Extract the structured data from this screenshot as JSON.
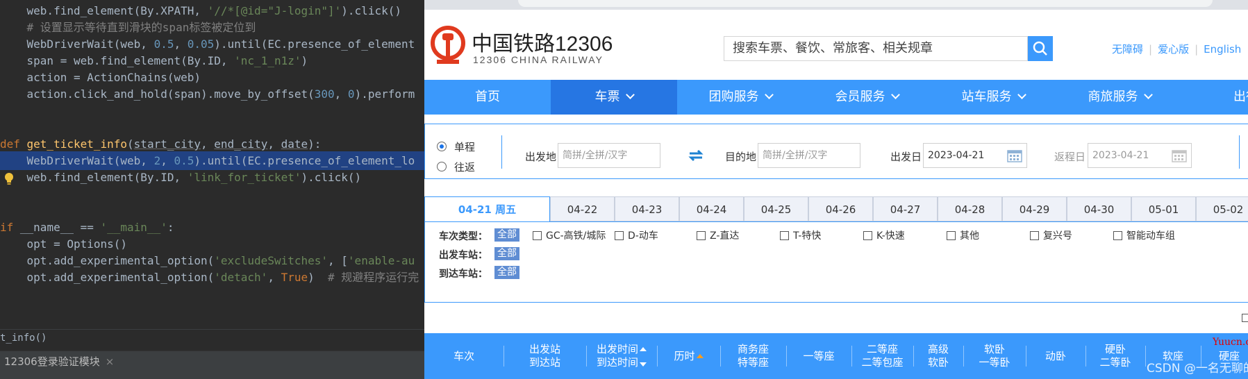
{
  "ide": {
    "lines": [
      [
        {
          "c": "",
          "t": "    web.find_element(By.XPATH, "
        },
        {
          "c": "str",
          "t": "'//*[@id=\"J-login\"]'"
        },
        {
          "c": "",
          "t": ").click()"
        }
      ],
      [
        {
          "c": "cmt",
          "t": "    # 设置显示等待直到滑块的span标签被定位到"
        }
      ],
      [
        {
          "c": "",
          "t": "    WebDriverWait(web, "
        },
        {
          "c": "num",
          "t": "0.5"
        },
        {
          "c": "",
          "t": ", "
        },
        {
          "c": "num",
          "t": "0.05"
        },
        {
          "c": "",
          "t": ").until(EC.presence_of_element"
        }
      ],
      [
        {
          "c": "",
          "t": "    span = web.find_element(By.ID, "
        },
        {
          "c": "str",
          "t": "'nc_1_n1z'"
        },
        {
          "c": "",
          "t": ")"
        }
      ],
      [
        {
          "c": "",
          "t": "    action = ActionChains(web)"
        }
      ],
      [
        {
          "c": "",
          "t": "    action.click_and_hold(span).move_by_offset("
        },
        {
          "c": "num",
          "t": "300"
        },
        {
          "c": "",
          "t": ", "
        },
        {
          "c": "num",
          "t": "0"
        },
        {
          "c": "",
          "t": ").perform"
        }
      ],
      [],
      [],
      [
        {
          "c": "kw",
          "t": "def "
        },
        {
          "c": "fn",
          "t": "get_ticket_info"
        },
        {
          "c": "",
          "t": "("
        },
        {
          "c": "param",
          "t": "start_city"
        },
        {
          "c": "",
          "t": ", "
        },
        {
          "c": "param",
          "t": "end_city"
        },
        {
          "c": "",
          "t": ", "
        },
        {
          "c": "param",
          "t": "date"
        },
        {
          "c": "",
          "t": "):"
        }
      ],
      [
        {
          "c": "",
          "t": "    WebDriverWait(web, "
        },
        {
          "c": "num",
          "t": "2"
        },
        {
          "c": "",
          "t": ", "
        },
        {
          "c": "num",
          "t": "0.5"
        },
        {
          "c": "",
          "t": ").until(EC.presence_of_element_lo"
        }
      ],
      [
        {
          "c": "",
          "t": "    web.find_element(By.ID, "
        },
        {
          "c": "str",
          "t": "'link_for_ticket'"
        },
        {
          "c": "",
          "t": ").click()"
        }
      ],
      [],
      [],
      [
        {
          "c": "kw",
          "t": "if "
        },
        {
          "c": "",
          "t": "__name__ == "
        },
        {
          "c": "str",
          "t": "'__main__'"
        },
        {
          "c": "",
          "t": ":"
        }
      ],
      [
        {
          "c": "",
          "t": "    opt = Options()"
        }
      ],
      [
        {
          "c": "",
          "t": "    opt.add_experimental_option("
        },
        {
          "c": "str",
          "t": "'excludeSwitches'"
        },
        {
          "c": "",
          "t": ", ["
        },
        {
          "c": "str",
          "t": "'enable-au"
        }
      ],
      [
        {
          "c": "",
          "t": "    opt.add_experimental_option("
        },
        {
          "c": "str",
          "t": "'detach'"
        },
        {
          "c": "",
          "t": ", "
        },
        {
          "c": "kw",
          "t": "True"
        },
        {
          "c": "",
          "t": ")  "
        },
        {
          "c": "cmt",
          "t": "# 规避程序运行完"
        }
      ]
    ],
    "status_line": "t_info()",
    "run_tab": "12306登录验证模块",
    "run_tab_close": "×"
  },
  "site": {
    "logo_cn": "中国铁路12306",
    "logo_en": "12306 CHINA RAILWAY",
    "search_placeholder": "搜索车票、餐饮、常旅客、相关规章",
    "header_links": [
      "无障碍",
      "爱心版",
      "English"
    ],
    "nav": [
      {
        "label": "首页",
        "chevron": false,
        "active": false
      },
      {
        "label": "车票",
        "chevron": true,
        "active": true
      },
      {
        "label": "团购服务",
        "chevron": true,
        "active": false
      },
      {
        "label": "会员服务",
        "chevron": true,
        "active": false
      },
      {
        "label": "站车服务",
        "chevron": true,
        "active": false
      },
      {
        "label": "商旅服务",
        "chevron": true,
        "active": false
      },
      {
        "label": "出行",
        "chevron": false,
        "active": false
      }
    ],
    "query": {
      "one_way": "单程",
      "round_trip": "往返",
      "from_label": "出发地",
      "from_placeholder": "简拼/全拼/汉字",
      "to_label": "目的地",
      "to_placeholder": "简拼/全拼/汉字",
      "depart_label": "出发日",
      "depart_value": "2023-04-21",
      "return_label": "返程日",
      "return_value": "2023-04-21"
    },
    "date_tabs": [
      "04-21 周五",
      "04-22",
      "04-23",
      "04-24",
      "04-25",
      "04-26",
      "04-27",
      "04-28",
      "04-29",
      "04-30",
      "05-01",
      "05-02"
    ],
    "filters": {
      "train_type_label": "车次类型：",
      "depart_station_label": "出发车站：",
      "arrive_station_label": "到达车站：",
      "all_label": "全部",
      "train_types": [
        "GC-高铁/城际",
        "D-动车",
        "Z-直达",
        "T-特快",
        "K-快速",
        "其他",
        "复兴号",
        "智能动车组"
      ]
    },
    "results_header": [
      {
        "l1": "车次",
        "l2": ""
      },
      {
        "l1": "出发站",
        "l2": "到达站"
      },
      {
        "l1": "出发时间",
        "l2": "到达时间"
      },
      {
        "l1": "历时",
        "l2": ""
      },
      {
        "l1": "商务座",
        "l2": "特等座"
      },
      {
        "l1": "一等座",
        "l2": ""
      },
      {
        "l1": "二等座",
        "l2": "二等包座"
      },
      {
        "l1": "高级",
        "l2": "软卧"
      },
      {
        "l1": "软卧",
        "l2": "一等卧"
      },
      {
        "l1": "动卧",
        "l2": ""
      },
      {
        "l1": "硬卧",
        "l2": "二等卧"
      },
      {
        "l1": "软座",
        "l2": ""
      },
      {
        "l1": "硬座",
        "l2": ""
      }
    ],
    "watermark": "Yuucn.com",
    "credit": "CSDN @一名无聊的网友"
  },
  "colors": {
    "brand_blue": "#3b99fc",
    "nav_active": "#2676e3",
    "logo_red": "#e03a1e",
    "sort_orange": "#ff9c1a"
  }
}
